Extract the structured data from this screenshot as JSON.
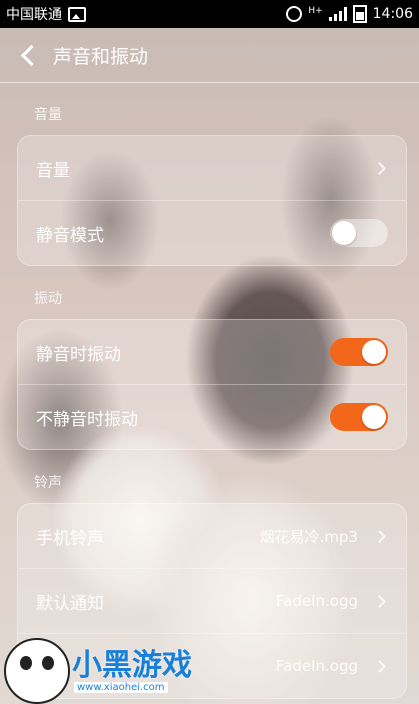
{
  "status_bar": {
    "carrier": "中国联通",
    "time": "14:06",
    "network": "H+"
  },
  "header": {
    "title": "声音和振动"
  },
  "sections": {
    "volume": {
      "label": "音量",
      "rows": [
        {
          "label": "音量"
        },
        {
          "label": "静音模式",
          "toggle": false
        }
      ]
    },
    "vibration": {
      "label": "振动",
      "rows": [
        {
          "label": "静音时振动",
          "toggle": true
        },
        {
          "label": "不静音时振动",
          "toggle": true
        }
      ]
    },
    "ringtone": {
      "label": "铃声",
      "rows": [
        {
          "label": "手机铃声",
          "value": "烟花易冷.mp3"
        },
        {
          "label": "默认通知",
          "value": "FadeIn.ogg"
        },
        {
          "value": "FadeIn.ogg"
        }
      ]
    }
  },
  "watermark": {
    "text": "小黑游戏",
    "url": "www.xiaohei.com"
  },
  "colors": {
    "toggle_on": "#f2671a",
    "statusbar_bg": "#000000"
  }
}
